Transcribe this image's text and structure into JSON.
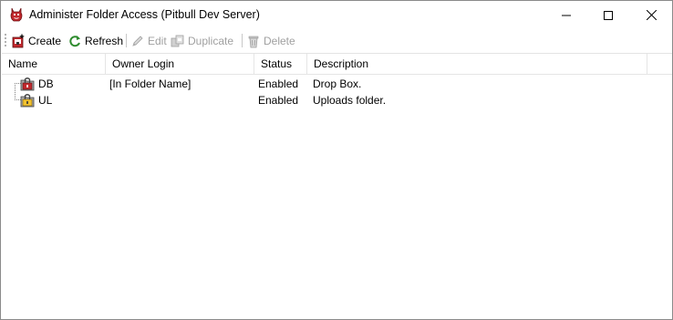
{
  "window": {
    "title": "Administer Folder Access (Pitbull Dev Server)",
    "icon": "app-devil-icon",
    "controls": [
      "minimize-icon",
      "maximize-icon",
      "close-icon"
    ]
  },
  "toolbar": {
    "create_label": "Create",
    "refresh_label": "Refresh",
    "edit_label": "Edit",
    "duplicate_label": "Duplicate",
    "delete_label": "Delete"
  },
  "list": {
    "columns": [
      "Name",
      "Owner Login",
      "Status",
      "Description"
    ],
    "rows": [
      {
        "name": "DB",
        "owner": "[In Folder Name]",
        "status": "Enabled",
        "description": "Drop Box.",
        "icon": "locked-folder-red-icon"
      },
      {
        "name": "UL",
        "owner": "",
        "status": "Enabled",
        "description": "Uploads folder.",
        "icon": "locked-folder-yellow-icon"
      }
    ]
  },
  "colors": {
    "accent_red": "#c0282d",
    "refresh_green": "#2e8b2e",
    "disabled_text": "#a0a0a0"
  }
}
